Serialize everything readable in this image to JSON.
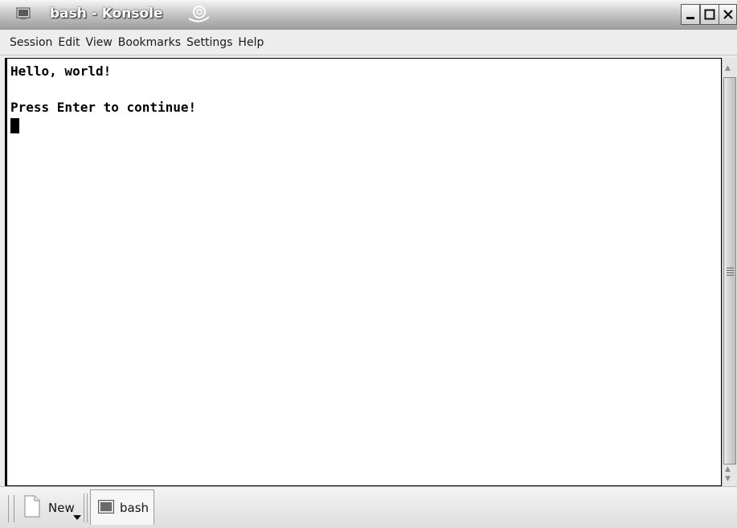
{
  "window": {
    "title": "bash - Konsole"
  },
  "menu": {
    "items": [
      "Session",
      "Edit",
      "View",
      "Bookmarks",
      "Settings",
      "Help"
    ]
  },
  "terminal": {
    "lines": [
      "Hello, world!",
      "Press Enter to continue!"
    ]
  },
  "tabbar": {
    "new_label": "New",
    "tabs": [
      {
        "label": "bash"
      }
    ]
  },
  "icons": {
    "app": "konsole-terminal-icon",
    "title_extra": "lifebuoy-icon",
    "new": "new-document-icon",
    "tab": "terminal-icon"
  },
  "colors": {
    "titlebar": "#b8b8b8",
    "terminal_bg": "#ffffff",
    "terminal_fg": "#000000"
  }
}
